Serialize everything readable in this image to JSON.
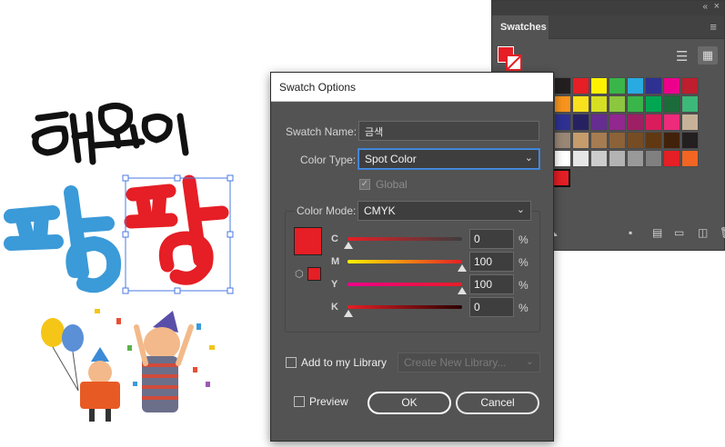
{
  "swatches_panel": {
    "tab_label": "Swatches",
    "collapse_glyph": "«",
    "close_glyph": "×",
    "menu_icon": "hamburger-menu-icon",
    "grid_colors": [
      "#231f20",
      "#e61e25",
      "#fff200",
      "#39b54a",
      "#29abe2",
      "#2e3192",
      "#ec008c",
      "#be1e2d",
      "#f7941d",
      "#f9e11e",
      "#d7df23",
      "#8dc63f",
      "#39b54a",
      "#00a651",
      "#1c6b3a",
      "#3cb878",
      "#2e3192",
      "#262262",
      "#662d91",
      "#92278f",
      "#9e1f63",
      "#da1c5c",
      "#ee2a7b",
      "#c7b299",
      "#998675",
      "#c69c6d",
      "#a67c52",
      "#8c6239",
      "#754c24",
      "#603913",
      "#42210b",
      "#231f20",
      "#ffffff",
      "#e6e6e6",
      "#cccccc",
      "#b3b3b3",
      "#999999",
      "#808080",
      "#e61e25",
      "#f26522"
    ],
    "selected_color": "#e61e25"
  },
  "dialog": {
    "title": "Swatch Options",
    "swatch_name": {
      "label": "Swatch Name:",
      "value": "금색"
    },
    "color_type": {
      "label": "Color Type:",
      "value": "Spot Color"
    },
    "global": {
      "label": "Global",
      "checked": true
    },
    "color_mode": {
      "label": "Color Mode:",
      "value": "CMYK"
    },
    "channels": [
      {
        "label": "C",
        "value": "0",
        "unit": "%"
      },
      {
        "label": "M",
        "value": "100",
        "unit": "%"
      },
      {
        "label": "Y",
        "value": "100",
        "unit": "%"
      },
      {
        "label": "K",
        "value": "0",
        "unit": "%"
      }
    ],
    "preview_color": "#e61e25",
    "library": {
      "label": "Add to my Library",
      "select_placeholder": "Create New Library..."
    },
    "preview": {
      "label": "Preview"
    },
    "ok_label": "OK",
    "cancel_label": "Cancel"
  },
  "artwork": {
    "line1_text": "헝요이",
    "line2_text": "팡팡",
    "colors": {
      "black": "#111111",
      "blue": "#3b9ad8",
      "red": "#e61e25"
    }
  }
}
